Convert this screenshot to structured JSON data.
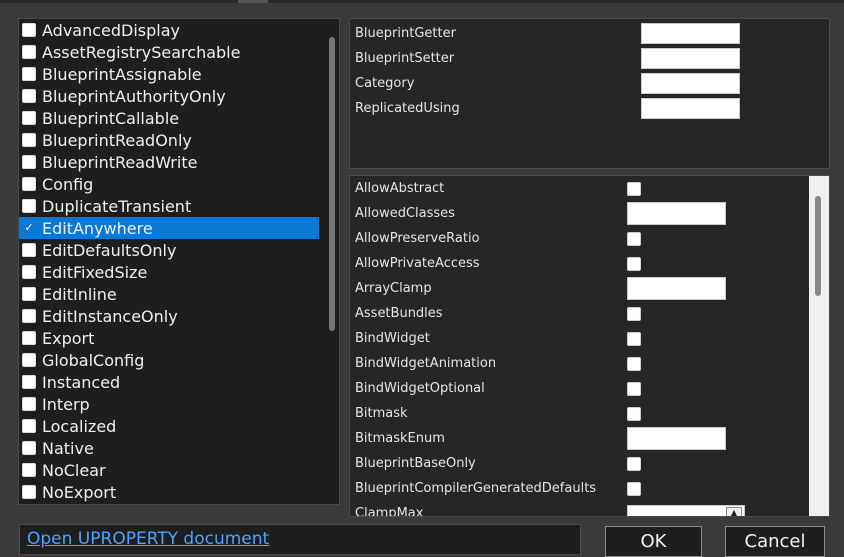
{
  "specifiers": [
    {
      "label": "AdvancedDisplay",
      "checked": false
    },
    {
      "label": "AssetRegistrySearchable",
      "checked": false
    },
    {
      "label": "BlueprintAssignable",
      "checked": false
    },
    {
      "label": "BlueprintAuthorityOnly",
      "checked": false
    },
    {
      "label": "BlueprintCallable",
      "checked": false
    },
    {
      "label": "BlueprintReadOnly",
      "checked": false
    },
    {
      "label": "BlueprintReadWrite",
      "checked": false
    },
    {
      "label": "Config",
      "checked": false
    },
    {
      "label": "DuplicateTransient",
      "checked": false
    },
    {
      "label": "EditAnywhere",
      "checked": true
    },
    {
      "label": "EditDefaultsOnly",
      "checked": false
    },
    {
      "label": "EditFixedSize",
      "checked": false
    },
    {
      "label": "EditInline",
      "checked": false
    },
    {
      "label": "EditInstanceOnly",
      "checked": false
    },
    {
      "label": "Export",
      "checked": false
    },
    {
      "label": "GlobalConfig",
      "checked": false
    },
    {
      "label": "Instanced",
      "checked": false
    },
    {
      "label": "Interp",
      "checked": false
    },
    {
      "label": "Localized",
      "checked": false
    },
    {
      "label": "Native",
      "checked": false
    },
    {
      "label": "NoClear",
      "checked": false
    },
    {
      "label": "NoExport",
      "checked": false
    }
  ],
  "selected_specifier": "EditAnywhere",
  "attributes": [
    {
      "label": "BlueprintGetter",
      "value": ""
    },
    {
      "label": "BlueprintSetter",
      "value": ""
    },
    {
      "label": "Category",
      "value": ""
    },
    {
      "label": "ReplicatedUsing",
      "value": ""
    }
  ],
  "metadata": [
    {
      "label": "AllowAbstract",
      "kind": "checkbox"
    },
    {
      "label": "AllowedClasses",
      "kind": "text"
    },
    {
      "label": "AllowPreserveRatio",
      "kind": "checkbox"
    },
    {
      "label": "AllowPrivateAccess",
      "kind": "checkbox"
    },
    {
      "label": "ArrayClamp",
      "kind": "text"
    },
    {
      "label": "AssetBundles",
      "kind": "checkbox"
    },
    {
      "label": "BindWidget",
      "kind": "checkbox"
    },
    {
      "label": "BindWidgetAnimation",
      "kind": "checkbox"
    },
    {
      "label": "BindWidgetOptional",
      "kind": "checkbox"
    },
    {
      "label": "Bitmask",
      "kind": "checkbox"
    },
    {
      "label": "BitmaskEnum",
      "kind": "text"
    },
    {
      "label": "BlueprintBaseOnly",
      "kind": "checkbox"
    },
    {
      "label": "BlueprintCompilerGeneratedDefaults",
      "kind": "checkbox"
    },
    {
      "label": "ClampMax",
      "kind": "stepper"
    }
  ],
  "footer": {
    "doc_link": "Open UPROPERTY document",
    "ok_label": "OK",
    "cancel_label": "Cancel"
  },
  "icons": {
    "checkmark": "check-icon",
    "stepper_up": "triangle-up-icon"
  },
  "colors": {
    "selection": "#0a78d7",
    "link": "#4da3ff",
    "panel": "#1e1e1e",
    "background": "#3a3a3a"
  }
}
